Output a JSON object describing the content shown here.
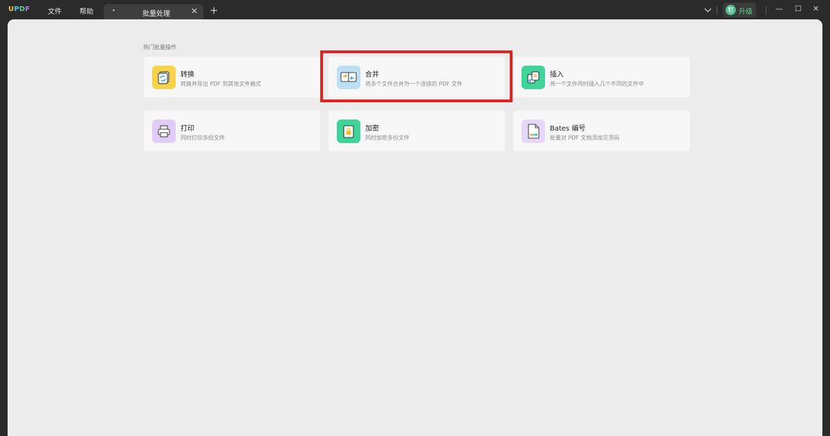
{
  "app": {
    "logo": {
      "u": "U",
      "p": "P",
      "d": "D",
      "f": "F"
    },
    "menu": {
      "file": "文件",
      "help": "帮助"
    }
  },
  "tab": {
    "dot": "•",
    "label": "批量处理",
    "close": "✕",
    "add": "+"
  },
  "titlebar": {
    "dropdown_icon": "chevron-down-icon",
    "upgrade_badge": "钉",
    "upgrade_label": "升级",
    "minimize_icon": "—",
    "maximize_icon": "☐",
    "close_icon": "✕"
  },
  "main": {
    "section_title": "热门批量操作",
    "cards": [
      {
        "title": "转换",
        "desc": "转换并导出 PDF 到其他文件格式",
        "icon": "convert-icon",
        "color": "#f7d34a"
      },
      {
        "title": "合并",
        "desc": "将多个文件合并为一个连续的 PDF 文件",
        "icon": "merge-icon",
        "color": "#bcdff5"
      },
      {
        "title": "插入",
        "desc": "将一个文件同时插入几个不同的文件中",
        "icon": "insert-icon",
        "color": "#3ed49a"
      },
      {
        "title": "打印",
        "desc": "同时打印多份文件",
        "icon": "print-icon",
        "color": "#e0ccf7"
      },
      {
        "title": "加密",
        "desc": "同时加密多份文件",
        "icon": "lock-icon",
        "color": "#3ed49a"
      },
      {
        "title": "Bates 编号",
        "desc": "批量对 PDF 文档添加贝茨码",
        "icon": "bates-icon",
        "color": "#e6d6f7"
      }
    ]
  },
  "annotation": {
    "highlight_color": "#e32222"
  }
}
